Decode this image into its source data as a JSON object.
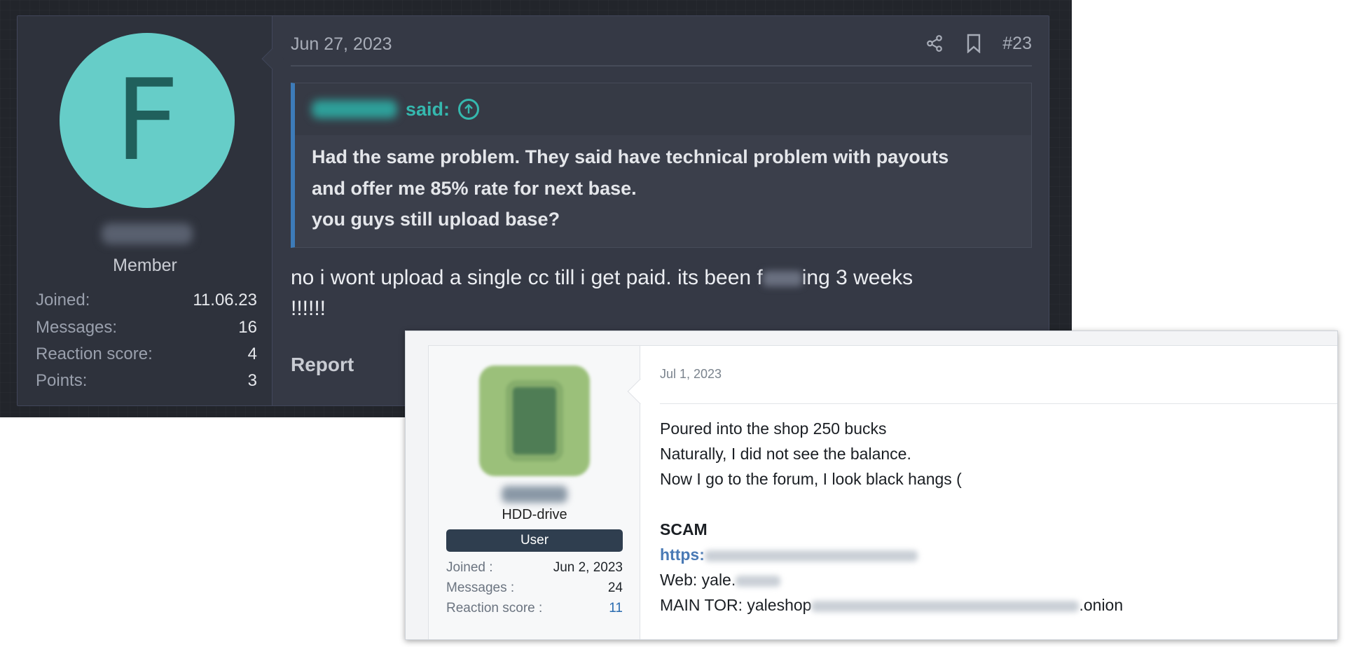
{
  "dark_post": {
    "date": "Jun 27, 2023",
    "post_number": "#23",
    "avatar_letter": "F",
    "role": "Member",
    "stats": [
      {
        "label": "Joined:",
        "value": "11.06.23"
      },
      {
        "label": "Messages:",
        "value": "16"
      },
      {
        "label": "Reaction score:",
        "value": "4"
      },
      {
        "label": "Points:",
        "value": "3"
      }
    ],
    "quote": {
      "said_label": "said:",
      "lines": [
        "Had the same problem. They said have technical problem with payouts",
        "and offer me 85% rate for next base.",
        "you guys still upload base?"
      ]
    },
    "message_part1": "no i wont upload a single cc till i get paid. its been f",
    "message_part2": "ing 3 weeks",
    "message_line2": "!!!!!!",
    "report_label": "Report",
    "icons": {
      "share": "share-icon",
      "bookmark": "bookmark-icon",
      "quote_up": "arrow-up-circle-icon"
    }
  },
  "light_post": {
    "date": "Jul 1, 2023",
    "rank": "HDD-drive",
    "badge": "User",
    "stats": [
      {
        "label": "Joined :",
        "value": "Jun 2, 2023"
      },
      {
        "label": "Messages :",
        "value": "24"
      },
      {
        "label": "Reaction score :",
        "value": "11"
      }
    ],
    "lines": [
      "Poured into the shop 250 bucks",
      "Naturally, I did not see the balance.",
      "Now I go to the forum, I look black hangs ("
    ],
    "scam_label": "SCAM",
    "url_prefix": "https:",
    "web_prefix": "Web: yale.",
    "tor_prefix": "MAIN TOR: yaleshop",
    "tor_suffix": ".onion"
  },
  "colors": {
    "dark_accent": "#35b8ae",
    "quote_border": "#3d7bb8",
    "light_badge": "#2f3e4f",
    "avatar": "#66cdc8"
  }
}
